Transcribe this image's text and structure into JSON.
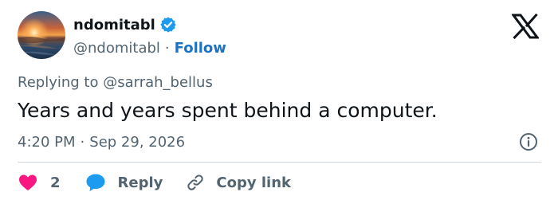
{
  "author": {
    "display_name": "ndomitabl",
    "handle": "@ndomitabl",
    "separator": "·",
    "follow_label": "Follow",
    "verified": true
  },
  "reply_context": {
    "prefix": "Replying to",
    "mention": "@sarrah_bellus"
  },
  "tweet": {
    "text": "Years and years spent behind a computer."
  },
  "meta": {
    "time": "4:20 PM",
    "separator": "·",
    "date": "Sep 29, 2026"
  },
  "actions": {
    "like_count": "2",
    "reply_label": "Reply",
    "copy_link_label": "Copy link"
  },
  "colors": {
    "verified_blue": "#1d9bf0",
    "follow_blue": "#1d72c4",
    "heart_pink": "#f91880",
    "reply_bubble_blue": "#1d9bf0",
    "muted_gray": "#536471",
    "text_black": "#0f1419",
    "divider": "#cfd9de"
  },
  "icons": {
    "platform_logo": "x-logo-icon",
    "verified": "verified-badge-icon",
    "info": "info-icon",
    "like": "heart-icon",
    "reply": "speech-bubble-icon",
    "copy_link": "link-icon"
  }
}
